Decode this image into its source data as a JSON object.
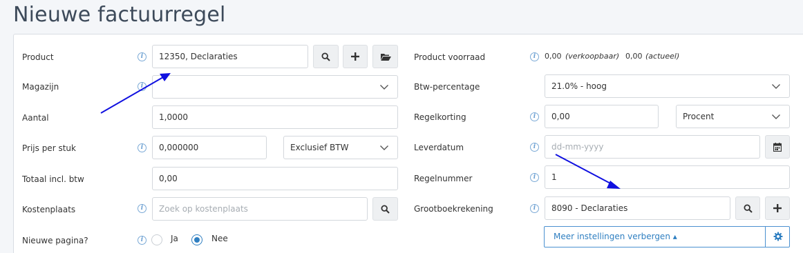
{
  "page": {
    "title": "Nieuwe factuurregel"
  },
  "left": {
    "product": {
      "label": "Product",
      "value": "12350, Declaraties"
    },
    "magazijn": {
      "label": "Magazijn",
      "value": ""
    },
    "aantal": {
      "label": "Aantal",
      "value": "1,0000"
    },
    "prijs": {
      "label": "Prijs per stuk",
      "value": "0,000000",
      "btw_mode": "Exclusief BTW"
    },
    "totaal": {
      "label": "Totaal incl. btw",
      "value": "0,00"
    },
    "kostenplaats": {
      "label": "Kostenplaats",
      "placeholder": "Zoek op kostenplaats"
    },
    "nieuwe_pagina": {
      "label": "Nieuwe pagina?",
      "options": [
        "Ja",
        "Nee"
      ],
      "selected": "Nee"
    }
  },
  "right": {
    "voorraad": {
      "label": "Product voorraad",
      "verkoopbaar_value": "0,00",
      "verkoopbaar_label": "(verkoopbaar)",
      "actueel_value": "0,00",
      "actueel_label": "(actueel)"
    },
    "btw": {
      "label": "Btw-percentage",
      "value": "21.0% - hoog"
    },
    "regelkorting": {
      "label": "Regelkorting",
      "value": "0,00",
      "unit": "Procent"
    },
    "leverdatum": {
      "label": "Leverdatum",
      "placeholder": "dd-mm-yyyy"
    },
    "regelnummer": {
      "label": "Regelnummer",
      "value": "1"
    },
    "grootboek": {
      "label": "Grootboekrekening",
      "value": "8090 - Declaraties"
    },
    "meer_instellingen": {
      "label": "Meer instellingen verbergen ▴"
    }
  },
  "icons": {
    "info": "info-icon",
    "search": "search-icon",
    "plus": "plus-icon",
    "folder": "folder-open-icon",
    "calendar": "calendar-icon",
    "chevron": "chevron-down-icon",
    "gear": "gear-icon"
  },
  "colors": {
    "accent": "#2f7fc1",
    "arrow": "#1010e0",
    "info": "#6a9fd2"
  }
}
